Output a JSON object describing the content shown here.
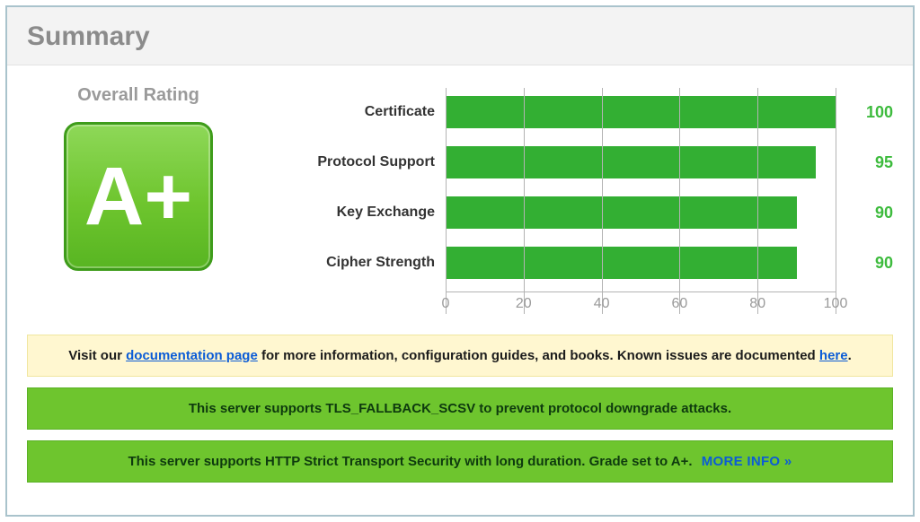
{
  "header": {
    "title": "Summary"
  },
  "rating": {
    "title": "Overall Rating",
    "grade": "A+"
  },
  "chart_data": {
    "type": "bar",
    "orientation": "horizontal",
    "categories": [
      "Certificate",
      "Protocol Support",
      "Key Exchange",
      "Cipher Strength"
    ],
    "values": [
      100,
      95,
      90,
      90
    ],
    "xlabel": "",
    "ylabel": "",
    "xlim": [
      0,
      100
    ],
    "ticks": [
      0,
      20,
      40,
      60,
      80,
      100
    ],
    "grid": true,
    "bar_color": "#33af33"
  },
  "banners": {
    "info": {
      "pre": "Visit our ",
      "link1": "documentation page",
      "mid": " for more information, configuration guides, and books. Known issues are documented ",
      "link2": "here",
      "post": "."
    },
    "scsv": {
      "pre": "This server supports ",
      "bold": "TLS_FALLBACK_SCSV",
      "post": " to prevent protocol downgrade attacks."
    },
    "hsts": {
      "text": "This server supports HTTP Strict Transport Security with long duration. Grade set to A+.",
      "more": "MORE INFO »"
    }
  }
}
